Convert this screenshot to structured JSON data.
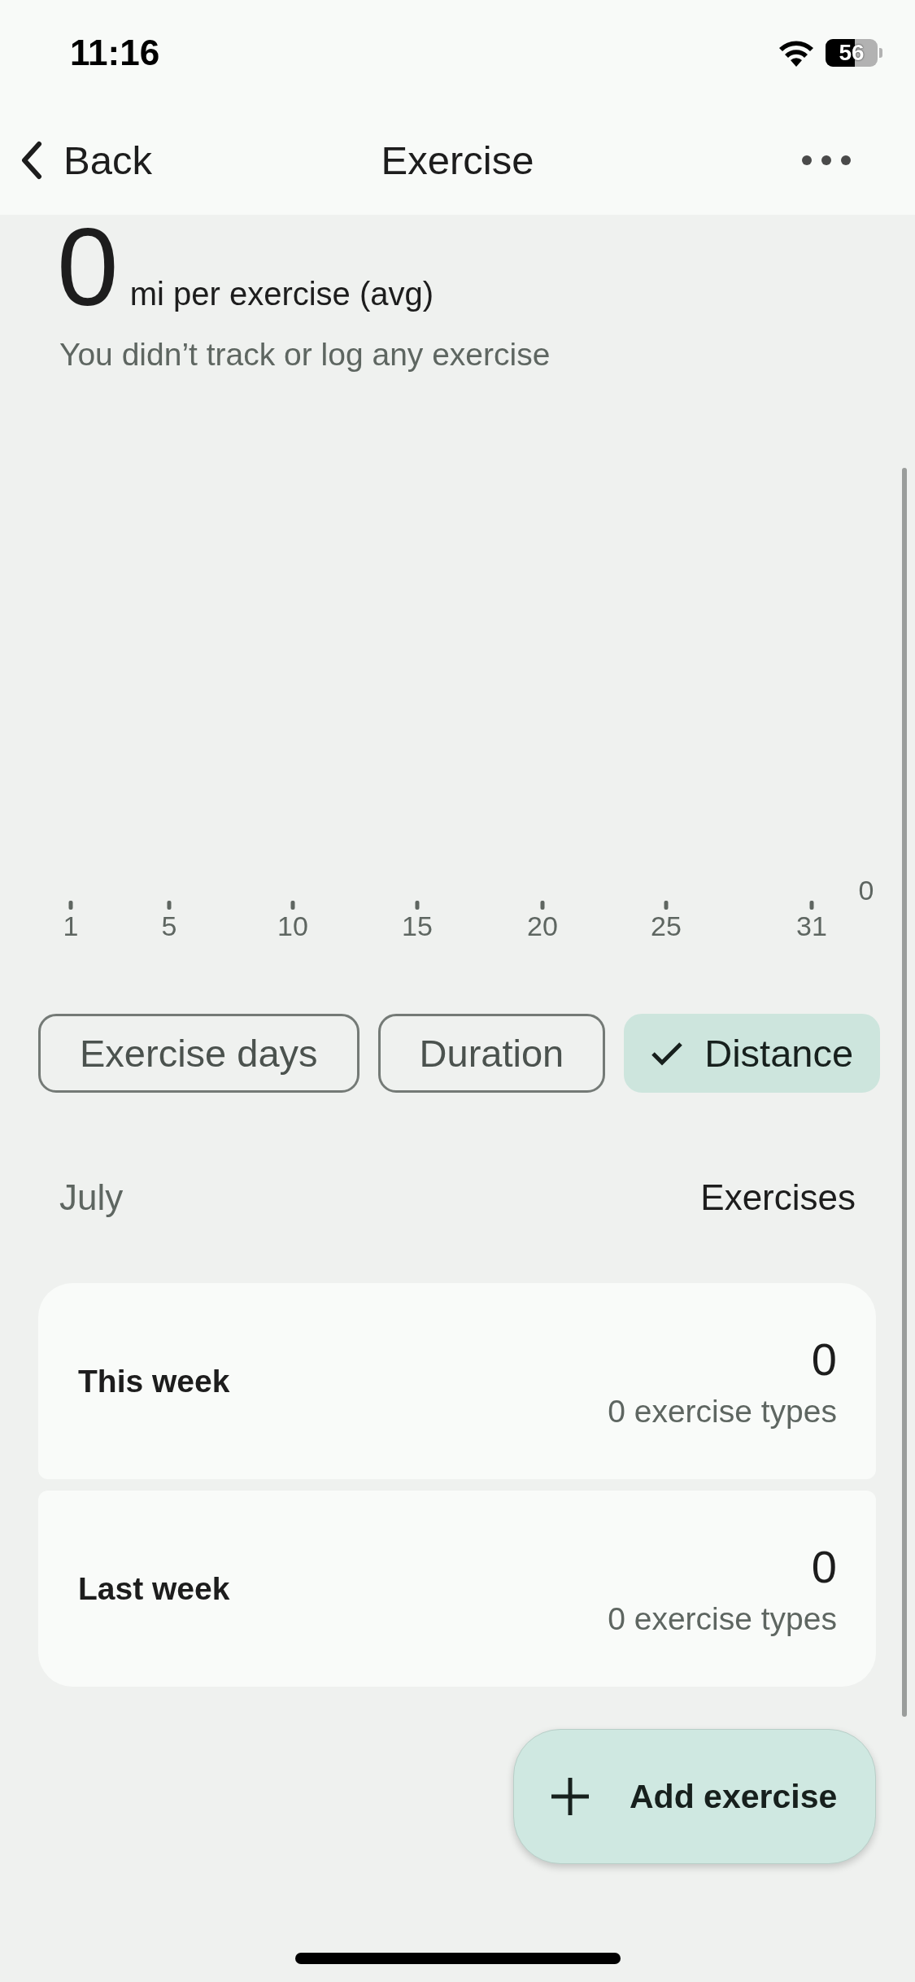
{
  "status_bar": {
    "time": "11:16",
    "battery": "56"
  },
  "header": {
    "back": "Back",
    "title": "Exercise"
  },
  "summary": {
    "value": "0",
    "unit": "mi per exercise (avg)",
    "message": "You didn’t track or log any exercise"
  },
  "chart": {
    "x_labels": [
      "1",
      "5",
      "10",
      "15",
      "20",
      "25",
      "31"
    ],
    "y_label": "0"
  },
  "filters": [
    {
      "label": "Exercise days",
      "selected": false
    },
    {
      "label": "Duration",
      "selected": false
    },
    {
      "label": "Distance",
      "selected": true
    }
  ],
  "list_header": {
    "month": "July",
    "column": "Exercises"
  },
  "weeks": [
    {
      "label": "This week",
      "count": "0",
      "types": "0 exercise types"
    },
    {
      "label": "Last week",
      "count": "0",
      "types": "0 exercise types"
    }
  ],
  "fab": {
    "label": "Add exercise"
  }
}
